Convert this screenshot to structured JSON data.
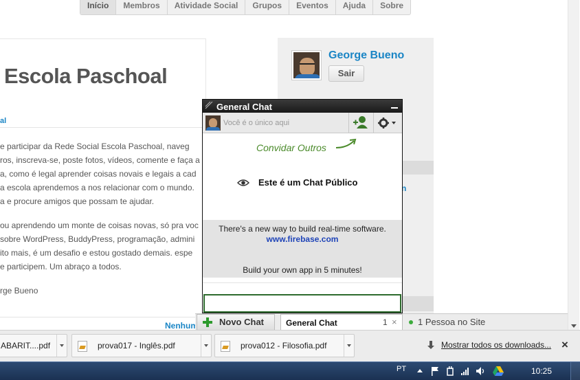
{
  "nav": {
    "tabs": [
      {
        "label": "Início",
        "active": true
      },
      {
        "label": "Membros"
      },
      {
        "label": "Atividade Social"
      },
      {
        "label": "Grupos"
      },
      {
        "label": "Eventos"
      },
      {
        "label": "Ajuda"
      },
      {
        "label": "Sobre"
      }
    ]
  },
  "post": {
    "title": "Escola Paschoal",
    "category": "al",
    "lines": [
      "e participar da Rede Social Escola Paschoal, naveg",
      "ros, inscreva-se, poste fotos, vídeos, comente e faça a",
      "a, como é legal aprender coisas novais e legais a cad",
      "a escola aprendemos a nos relacionar com o mundo.",
      "a e procure amigos que possam te ajudar.",
      "ou aprendendo um monte de coisas novas, só pra voc",
      "sobre WordPress, BuddyPress, programação, admini",
      "ito mais, é um desafio e estou gostado demais. espe",
      "e participem. Um abraço a todos.",
      "rge Bueno"
    ],
    "footer_link": "Nenhum"
  },
  "profile": {
    "name": "George Bueno",
    "logout_label": "Sair"
  },
  "chat": {
    "title": "General Chat",
    "status_placeholder": "Você é o único aqui",
    "invite_label": "Convidar Outros",
    "public_label": "Este é um Chat Público",
    "ad": {
      "line1": "There's a new way to build real-time software.",
      "link": "www.firebase.com",
      "line3": "Build your own app in 5 minutes!"
    },
    "input_value": ""
  },
  "chatbar": {
    "new_chat_label": "Novo Chat",
    "tab_label": "General Chat",
    "tab_count": "1",
    "tab_close": "×",
    "online_label": "1 Pessoa no Site"
  },
  "downloads": {
    "items": [
      {
        "name": "ABARIT....pdf"
      },
      {
        "name": "prova017 - Inglês.pdf"
      },
      {
        "name": "prova012 - Filosofia.pdf"
      }
    ],
    "show_all_label": "Mostrar todos os downloads...",
    "close": "×"
  },
  "taskbar": {
    "lang": "PT",
    "clock": "10:25"
  },
  "colors": {
    "link_blue": "#1a85c5",
    "chat_green": "#4a8a2a",
    "taskbar": "#1b3152"
  }
}
